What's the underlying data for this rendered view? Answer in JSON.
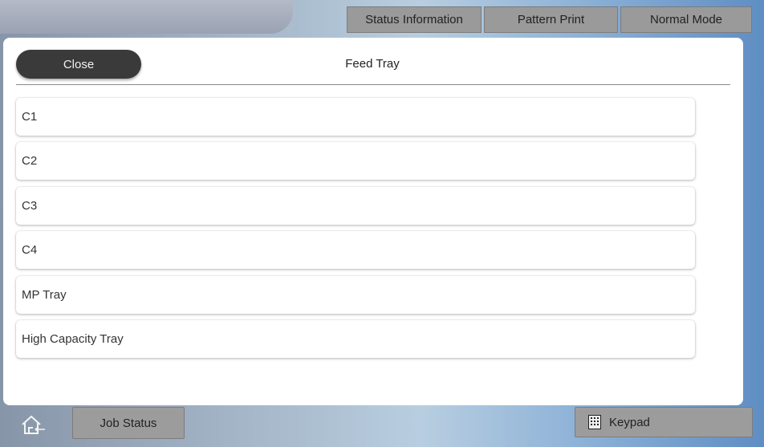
{
  "top_tabs": [
    {
      "label": "Status Information"
    },
    {
      "label": "Pattern Print"
    },
    {
      "label": "Normal Mode"
    }
  ],
  "panel": {
    "close_label": "Close",
    "title": "Feed Tray",
    "items": [
      {
        "label": "C1"
      },
      {
        "label": "C2"
      },
      {
        "label": "C3"
      },
      {
        "label": "C4"
      },
      {
        "label": "MP Tray"
      },
      {
        "label": "High Capacity Tray"
      }
    ]
  },
  "bottom_bar": {
    "home_icon": "home-icon",
    "job_status_label": "Job Status",
    "keypad_icon": "keypad-icon",
    "keypad_label": "Keypad"
  }
}
